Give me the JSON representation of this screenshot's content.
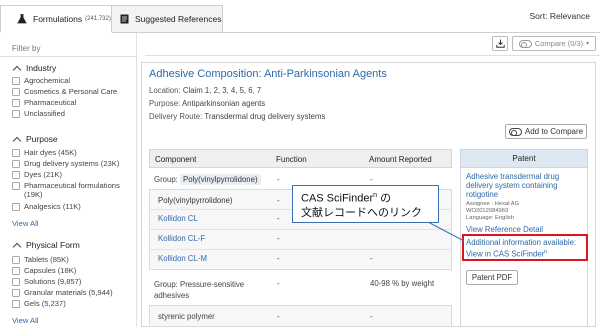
{
  "tabs": [
    {
      "label": "Formulations",
      "count": "(241,732)",
      "icon": "flask-icon"
    },
    {
      "label": "Suggested References",
      "icon": "document-icon"
    }
  ],
  "sort_label": "Sort: Relevance",
  "sidebar": {
    "filter_by": "Filter by",
    "sections": [
      {
        "title": "Industry",
        "items": [
          "Agrochemical",
          "Cosmetics & Personal Care",
          "Pharmaceutical",
          "Unclassified"
        ]
      },
      {
        "title": "Purpose",
        "items": [
          "Hair dyes (45K)",
          "Drug delivery systems (23K)",
          "Dyes (21K)",
          "Pharmaceutical formulations (19K)",
          "Analgesics (11K)"
        ],
        "view_all": "View All"
      },
      {
        "title": "Physical Form",
        "items": [
          "Tablets (85K)",
          "Capsules (18K)",
          "Solutions (9,857)",
          "Granular materials (5,944)",
          "Gels (5,237)"
        ],
        "view_all": "View All"
      }
    ]
  },
  "toolbar": {
    "compare_label": "Compare (0/3)"
  },
  "result": {
    "title": "Adhesive Composition: Anti-Parkinsonian Agents",
    "location_label": "Location:",
    "location_value": "Claim 1, 2, 3, 4, 5, 6, 7",
    "purpose_label": "Purpose:",
    "purpose_value": "Antiparkinsonian agents",
    "delivery_label": "Delivery Route:",
    "delivery_value": "Transdermal drug delivery systems",
    "add_compare": "Add to Compare"
  },
  "table": {
    "headers": [
      "Component",
      "Function",
      "Amount Reported"
    ],
    "group1_label": "Group:",
    "group1_name": "Poly(vinylpyrrolidone)",
    "group1_function": "-",
    "group1_amount": "-",
    "group1_items": [
      {
        "component": "Poly(vinylpyrrolidone)",
        "function": "-"
      },
      {
        "component": "Kollidon CL",
        "function": "-"
      },
      {
        "component": "Kollidon CL-F",
        "function": "-"
      },
      {
        "component": "Kollidon CL-M",
        "function": "-",
        "amount": "-"
      }
    ],
    "group2_label": "Group: Pressure-sensitive adhesives",
    "group2_function": "-",
    "group2_amount": "40-98 % by weight",
    "group2_items": [
      {
        "component": "styrenic polymer",
        "function": "-",
        "amount": "-"
      }
    ]
  },
  "patent": {
    "header": "Patent",
    "title": "Adhesive transdermal drug delivery system containing rotigotine",
    "assignee": "Assignee : Hexal AG",
    "number": "WO2012084969",
    "language": "Language: English",
    "view_detail": "View Reference Detail",
    "additional_1": "Additional information available:",
    "additional_2": "View in CAS SciFinder",
    "additional_sup": "n",
    "pdf": "Patent PDF"
  },
  "callout": {
    "line1": "CAS SciFinder",
    "line1_sup": "n",
    "line1_tail": " の",
    "line2": "文献レコードへのリンク"
  },
  "colors": {
    "link": "#2d6aa8",
    "highlight": "#e0141e",
    "callout_border": "#3c6eb4"
  }
}
